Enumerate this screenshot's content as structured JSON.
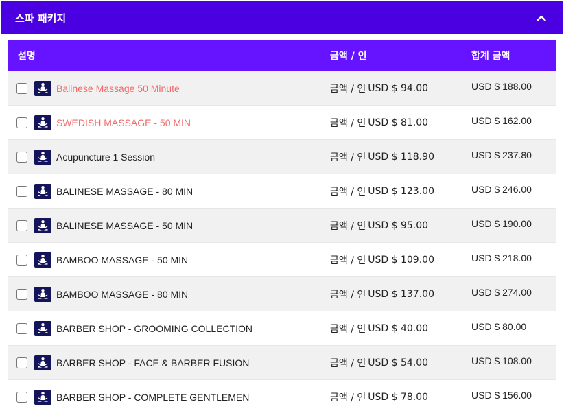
{
  "panel": {
    "title": "스파 패키지",
    "header_color": "#4a00e0"
  },
  "table": {
    "header_color": "#6614ff",
    "accent_color": "#f26a6a",
    "columns": {
      "description": "설명",
      "amount": "금액 / 인",
      "total": "합계 금액"
    },
    "rows": [
      {
        "name": "Balinese Massage 50 Minute",
        "amount_label": "금액 / 인",
        "amount": "USD $ 94.00",
        "total": "USD $ 188.00",
        "highlight": true,
        "icon": "meditation-icon"
      },
      {
        "name": "SWEDISH MASSAGE - 50 MIN",
        "amount_label": "금액 / 인",
        "amount": "USD $ 81.00",
        "total": "USD $ 162.00",
        "highlight": true,
        "icon": "meditation-icon"
      },
      {
        "name": "Acupuncture 1 Session",
        "amount_label": "금액 / 인",
        "amount": "USD $ 118.90",
        "total": "USD $ 237.80",
        "highlight": false,
        "icon": "meditation-icon"
      },
      {
        "name": "BALINESE MASSAGE - 80 MIN",
        "amount_label": "금액 / 인",
        "amount": "USD $ 123.00",
        "total": "USD $ 246.00",
        "highlight": false,
        "icon": "meditation-icon"
      },
      {
        "name": "BALINESE MASSAGE - 50 MIN",
        "amount_label": "금액 / 인",
        "amount": "USD $ 95.00",
        "total": "USD $ 190.00",
        "highlight": false,
        "icon": "meditation-icon"
      },
      {
        "name": "BAMBOO MASSAGE - 50 MIN",
        "amount_label": "금액 / 인",
        "amount": "USD $ 109.00",
        "total": "USD $ 218.00",
        "highlight": false,
        "icon": "meditation-icon"
      },
      {
        "name": "BAMBOO MASSAGE - 80 MIN",
        "amount_label": "금액 / 인",
        "amount": "USD $ 137.00",
        "total": "USD $ 274.00",
        "highlight": false,
        "icon": "meditation-icon"
      },
      {
        "name": "BARBER SHOP - GROOMING COLLECTION",
        "amount_label": "금액 / 인",
        "amount": "USD $ 40.00",
        "total": "USD $ 80.00",
        "highlight": false,
        "icon": "meditation-icon"
      },
      {
        "name": "BARBER SHOP - FACE & BARBER FUSION",
        "amount_label": "금액 / 인",
        "amount": "USD $ 54.00",
        "total": "USD $ 108.00",
        "highlight": false,
        "icon": "meditation-icon"
      },
      {
        "name": "BARBER SHOP - COMPLETE GENTLEMEN",
        "amount_label": "금액 / 인",
        "amount": "USD $ 78.00",
        "total": "USD $ 156.00",
        "highlight": false,
        "icon": "meditation-icon"
      }
    ]
  }
}
